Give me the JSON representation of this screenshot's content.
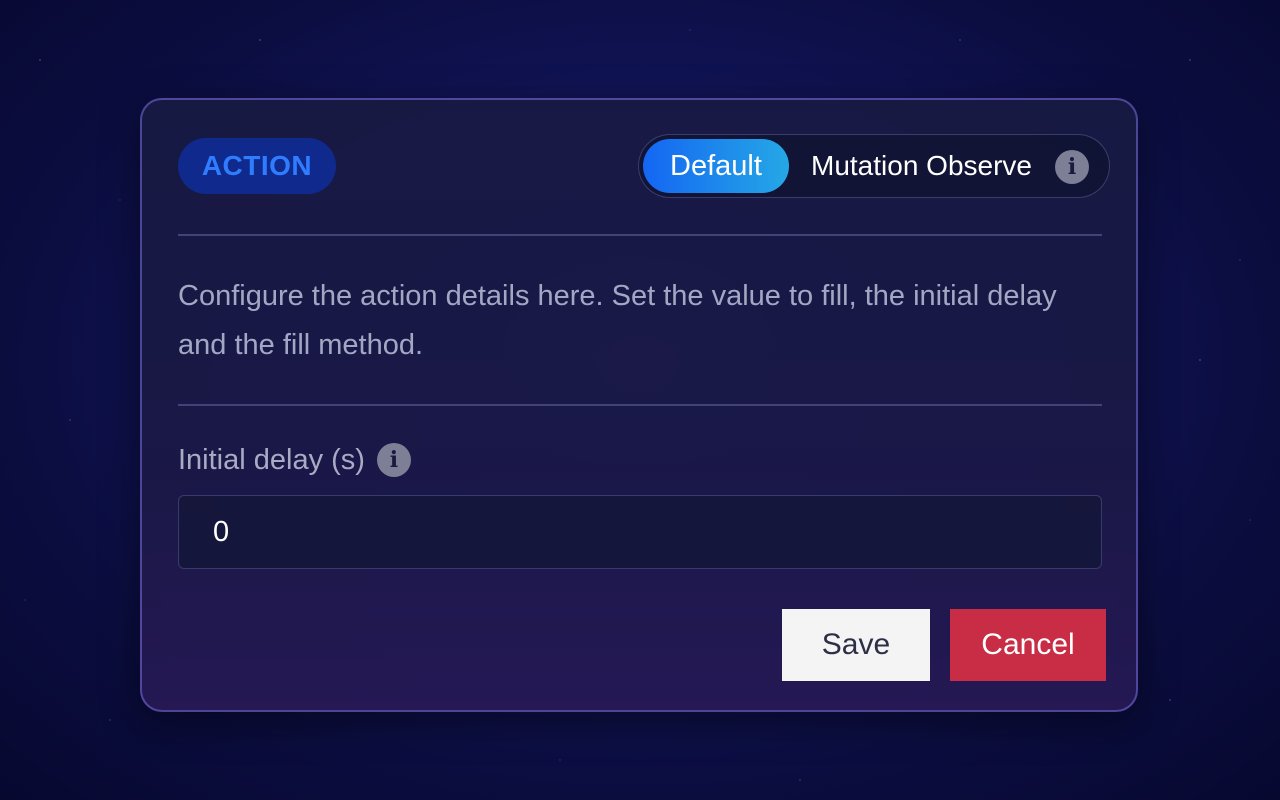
{
  "header": {
    "badge_label": "ACTION",
    "mode_toggle": {
      "options": [
        {
          "label": "Default",
          "selected": true
        },
        {
          "label": "Mutation Observe",
          "selected": false
        }
      ],
      "info_icon": "info-icon"
    }
  },
  "description": "Configure the action details here. Set the value to fill, the initial delay and the fill method.",
  "initial_delay": {
    "label": "Initial delay (s)",
    "info_icon": "info-icon",
    "value": "0"
  },
  "actions": {
    "save_label": "Save",
    "cancel_label": "Cancel"
  },
  "colors": {
    "badge_background": "#0f2a8c",
    "badge_text": "#2f7cff",
    "toggle_active_start": "#1466f2",
    "toggle_active_end": "#25a8e6",
    "save_background": "#f4f4f5",
    "cancel_background": "#c82d45"
  }
}
